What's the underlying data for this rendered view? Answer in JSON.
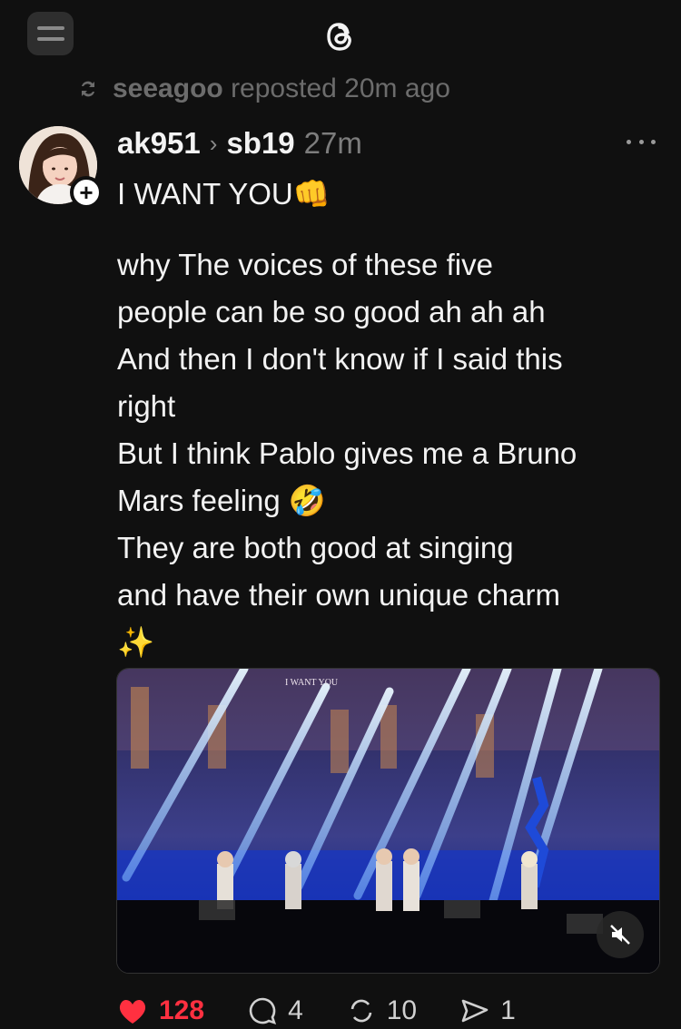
{
  "header": {
    "logo_icon": "threads-logo-icon",
    "menu_icon": "menu-icon"
  },
  "repost": {
    "icon": "repost-icon",
    "user": "seeagoo",
    "text": "reposted 20m ago"
  },
  "post": {
    "author": "ak951",
    "community": "sb19",
    "time": "27m",
    "lines": [
      "I WANT YOU👊",
      "why The voices of these five",
      "people can be so good ah ah ah",
      "And then I don't know if I said this",
      "right",
      "But I think Pablo gives me a Bruno",
      "Mars feeling 🤣",
      "They are both good at singing",
      "and have their own unique charm",
      "✨"
    ],
    "media": {
      "overlay_text": "I WANT YOU",
      "mute_icon": "muted-speaker-icon"
    }
  },
  "actions": {
    "likes": "128",
    "replies": "4",
    "reposts": "10",
    "shares": "1"
  },
  "colors": {
    "background": "#101010",
    "like": "#ff3040",
    "muted_text": "#7d7d7d"
  }
}
